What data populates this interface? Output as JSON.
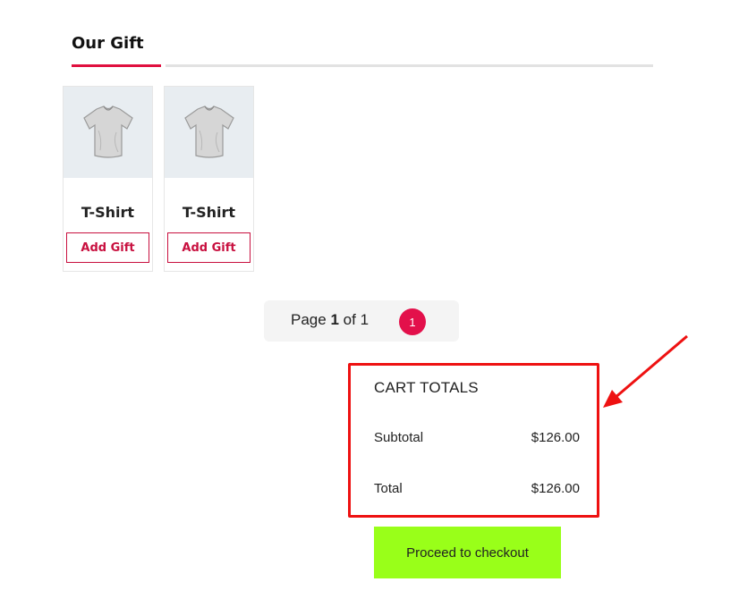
{
  "section": {
    "title": "Our Gift"
  },
  "products": [
    {
      "name": "T-Shirt",
      "button_label": "Add Gift",
      "icon": "tshirt-image"
    },
    {
      "name": "T-Shirt",
      "button_label": "Add Gift",
      "icon": "tshirt-image"
    }
  ],
  "pagination": {
    "prefix": "Page",
    "current": "1",
    "separator": "of",
    "total": "1",
    "page_button": "1"
  },
  "cart_totals": {
    "heading": "CART TOTALS",
    "subtotal_label": "Subtotal",
    "subtotal_value": "$126.00",
    "total_label": "Total",
    "total_value": "$126.00"
  },
  "checkout": {
    "label": "Proceed to checkout"
  },
  "colors": {
    "accent": "#e0103f",
    "highlight_box": "#ee1111",
    "checkout_bg": "#99ff19"
  }
}
